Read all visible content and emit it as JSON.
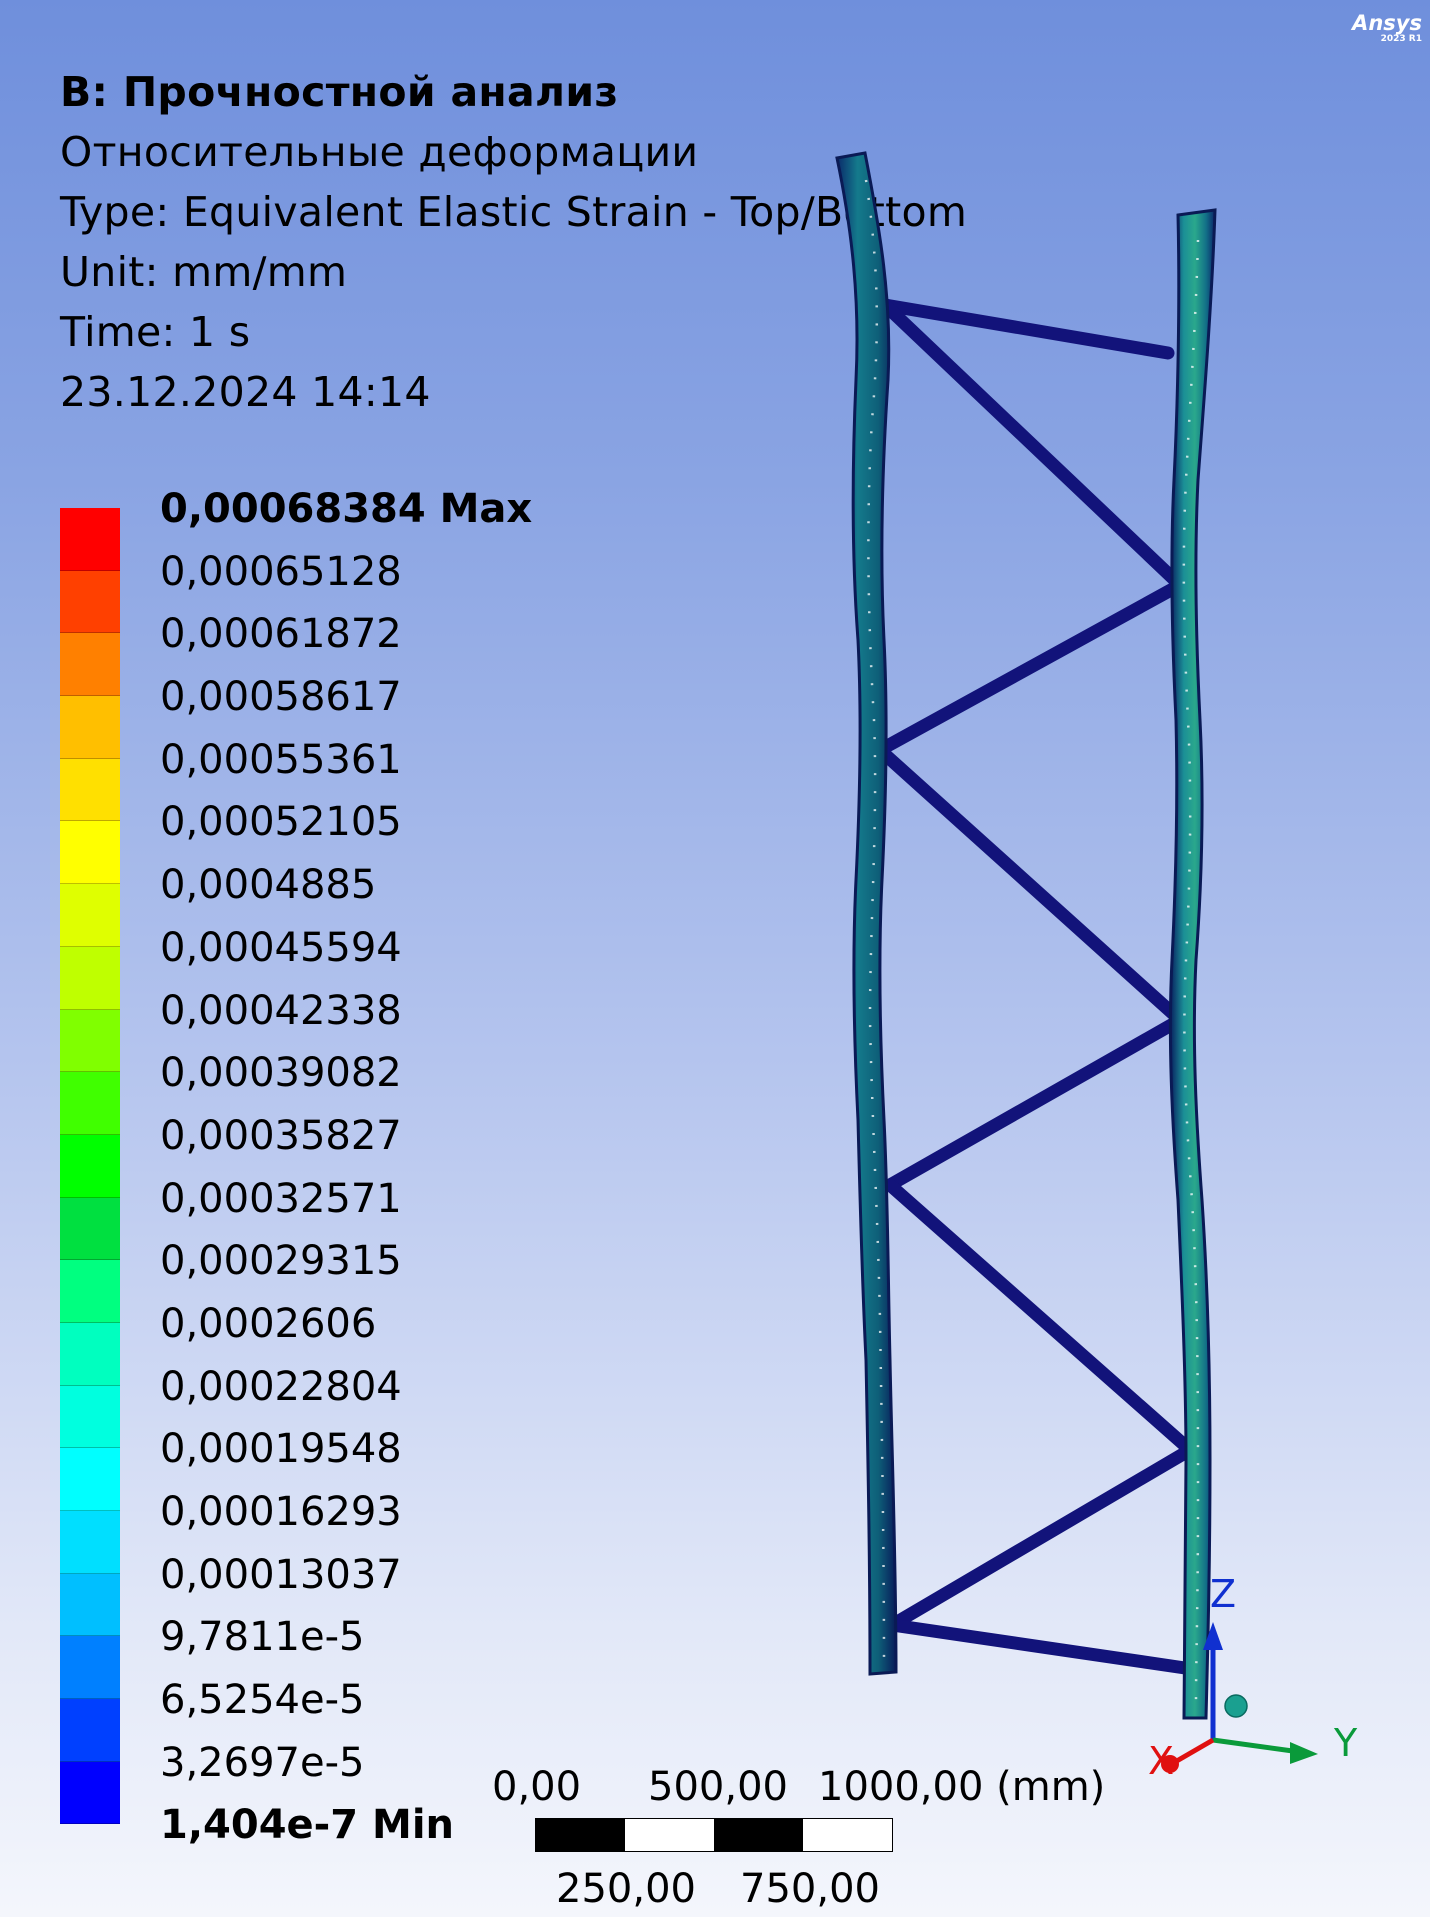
{
  "branding": {
    "name": "Ansys",
    "version": "2023 R1"
  },
  "header": {
    "title": "B: Прочностной анализ",
    "result_name": "Относительные деформации",
    "type": "Type: Equivalent Elastic Strain - Top/Bottom",
    "unit": "Unit: mm/mm",
    "time": "Time: 1 s",
    "timestamp": "23.12.2024 14:14"
  },
  "legend": {
    "labels": [
      "0,00068384 Max",
      "0,00065128",
      "0,00061872",
      "0,00058617",
      "0,00055361",
      "0,00052105",
      "0,0004885",
      "0,00045594",
      "0,00042338",
      "0,00039082",
      "0,00035827",
      "0,00032571",
      "0,00029315",
      "0,0002606",
      "0,00022804",
      "0,00019548",
      "0,00016293",
      "0,00013037",
      "9,7811e-5",
      "6,5254e-5",
      "3,2697e-5",
      "1,404e-7 Min"
    ],
    "colors": [
      "#ff0000",
      "#ff4000",
      "#ff8000",
      "#ffbf00",
      "#ffe000",
      "#ffff00",
      "#dfff00",
      "#bfff00",
      "#80ff00",
      "#40ff00",
      "#00ff00",
      "#00e040",
      "#00ff80",
      "#00ffbf",
      "#00ffdf",
      "#00ffff",
      "#00dfff",
      "#00bfff",
      "#0080ff",
      "#0040ff",
      "#0000ff"
    ]
  },
  "scale": {
    "top_labels": [
      "0,00",
      "500,00",
      "1000,00 (mm)"
    ],
    "bottom_labels": [
      "250,00",
      "750,00"
    ]
  },
  "triad": {
    "x": "X",
    "y": "Y",
    "z": "Z"
  }
}
